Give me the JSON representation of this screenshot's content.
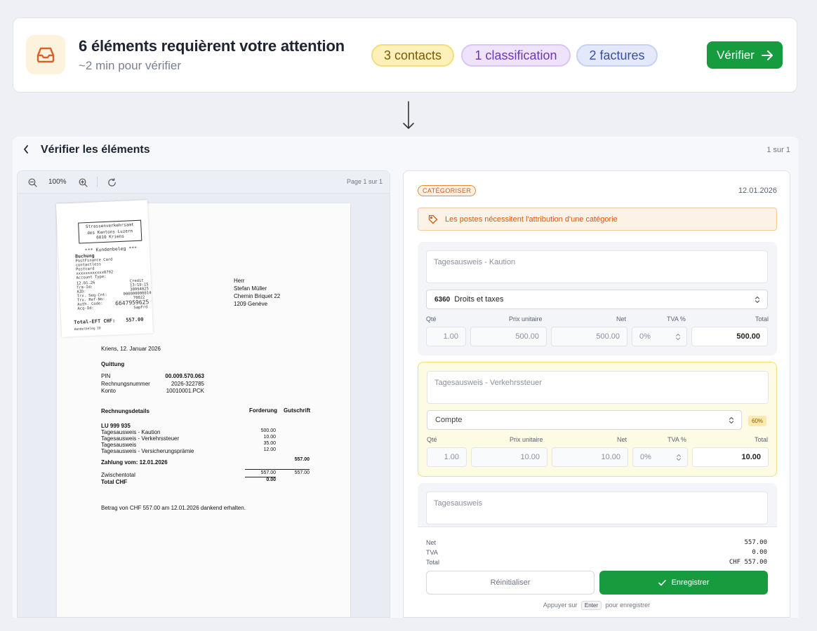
{
  "banner": {
    "title": "6 éléments requièrent votre attention",
    "subtitle": "~2 min pour vérifier",
    "icon": "inbox-icon",
    "pills": {
      "contacts": "3 contacts",
      "classification": "1 classification",
      "factures": "2 factures"
    },
    "verify_label": "Vérifier",
    "colors": {
      "accent_green": "#169b3f",
      "icon_bg": "#fdf3dc",
      "icon_color": "#d9622b"
    }
  },
  "review": {
    "title": "Vérifier les éléments",
    "count": "1 sur 1",
    "viewer": {
      "zoom": "100%",
      "page": "Page 1 sur 1"
    },
    "document": {
      "receipt": {
        "header_lines": [
          "Strassenverkehrsamt",
          "des Kantons Luzern",
          "6010 Kriens"
        ],
        "title": "*** Kundenbeleg ***",
        "booking": "Buchung",
        "lines": [
          "PostFinance Card",
          "contactless",
          "Postcard",
          "xxxxxxxxxxxx0792",
          "Account Type:",
          "12.01.26",
          "Trm-Id:",
          "AID:",
          "Trx. Seq-Cnt:",
          "Trx. Ref-No:",
          "Auth. Code:",
          "Acq-Id:"
        ],
        "right_values": [
          "Credit",
          "13:19:15",
          "30954025",
          "0000000000140",
          "70022",
          "6647959625",
          "SapFrd"
        ],
        "total_label": "Total-EFT CHF:",
        "total_value": "557.00",
        "footer": "Handelbeleg ID"
      },
      "address": [
        "Herr",
        "Stefan Müller",
        "Chemin Briquet 22",
        "1209 Genève"
      ],
      "date_line": "Kriens, 12. Januar 2026",
      "receipt_heading": "Quittung",
      "info_rows": [
        {
          "label": "PIN",
          "value": "00.009.570.063"
        },
        {
          "label": "Rechnungsnummer",
          "value": "2026-322785"
        },
        {
          "label": "Konto",
          "value": "10010001.PCK"
        }
      ],
      "details_heading": "Rechnungsdetails",
      "col_forderung": "Forderung",
      "col_gutschrift": "Gutschrift",
      "plate": "LU 999 935",
      "items": [
        {
          "label": "Tagesausweis - Kaution",
          "value": "500.00"
        },
        {
          "label": "Tagesausweis - Verkehrssteuer",
          "value": "10.00"
        },
        {
          "label": "Tagesausweis",
          "value": "35.00"
        },
        {
          "label": "Tagesausweis - Versicherungsprämie",
          "value": "12.00"
        }
      ],
      "payment_line": "Zahlung vom: 12.01.2026",
      "payment_value": "557.00",
      "subtotal_label": "Zwischentotal",
      "subtotal_forderung": "557.00",
      "subtotal_gutschrift": "557.00",
      "total_label": "Total CHF",
      "total_value": "0.00",
      "thanks": "Betrag von CHF 557.00 am 12.01.2026 dankend erhalten."
    },
    "form": {
      "badge": "CATÉGORISER",
      "date": "12.01.2026",
      "alert": "Les postes nécessitent l'attribution d'une catégorie",
      "columns": {
        "qty": "Qté",
        "unit_price": "Prix unitaire",
        "net": "Net",
        "tva": "TVA %",
        "total": "Total"
      },
      "items": [
        {
          "description": "Tagesausweis - Kaution",
          "account_code": "6360",
          "account_name": "Droits et taxes",
          "qty": "1.00",
          "unit_price": "500.00",
          "net": "500.00",
          "tva": "0%",
          "total": "500.00"
        },
        {
          "description": "Tagesausweis - Verkehrssteuer",
          "account_placeholder": "Compte",
          "confidence": "60%",
          "qty": "1.00",
          "unit_price": "10.00",
          "net": "10.00",
          "tva": "0%",
          "total": "10.00"
        },
        {
          "description": "Tagesausweis"
        }
      ],
      "summary": [
        {
          "label": "Net",
          "value": "557.00"
        },
        {
          "label": "TVA",
          "value": "0.00"
        },
        {
          "label": "Total",
          "value": "CHF 557.00"
        }
      ],
      "reset_label": "Réinitialiser",
      "save_label": "Enregistrer",
      "hint_before": "Appuyer sur",
      "hint_key": "Enter",
      "hint_after": "pour enregistrer"
    }
  }
}
